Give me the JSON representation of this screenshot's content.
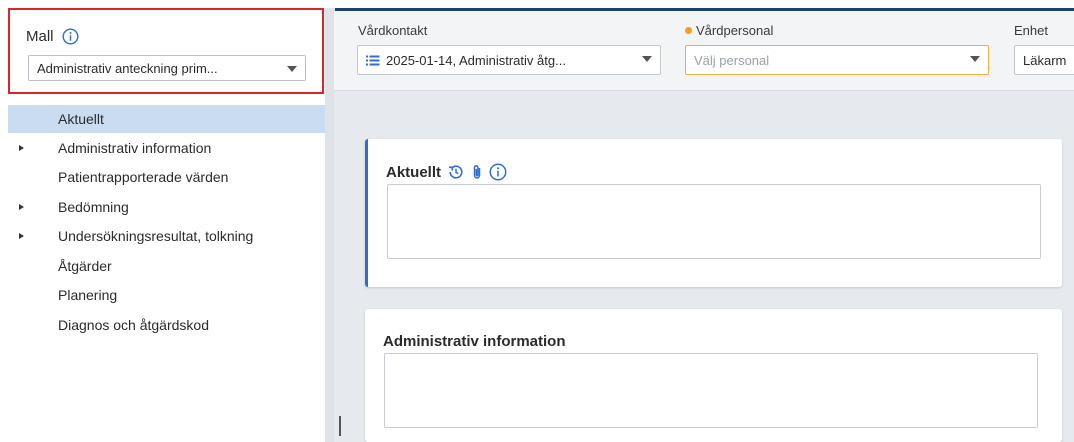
{
  "mall": {
    "label": "Mall",
    "selected": "Administrativ anteckning prim..."
  },
  "nav": {
    "items": [
      {
        "label": "Aktuellt",
        "expandable": false,
        "active": true
      },
      {
        "label": "Administrativ information",
        "expandable": true,
        "active": false
      },
      {
        "label": "Patientrapporterade värden",
        "expandable": false,
        "active": false
      },
      {
        "label": "Bedömning",
        "expandable": true,
        "active": false
      },
      {
        "label": "Undersökningsresultat, tolkning",
        "expandable": true,
        "active": false
      },
      {
        "label": "Åtgärder",
        "expandable": false,
        "active": false
      },
      {
        "label": "Planering",
        "expandable": false,
        "active": false
      },
      {
        "label": "Diagnos och åtgärdskod",
        "expandable": false,
        "active": false
      }
    ]
  },
  "header": {
    "vardkontakt": {
      "label": "Vårdkontakt",
      "value": "2025-01-14, Administrativ åtg..."
    },
    "vardpersonal": {
      "label": "Vårdpersonal",
      "placeholder": "Välj personal"
    },
    "enhet": {
      "label": "Enhet",
      "value": "Läkarm"
    }
  },
  "sections": {
    "aktuellt": {
      "title": "Aktuellt"
    },
    "administrativ": {
      "title": "Administrativ information"
    }
  },
  "colors": {
    "accent": "#2d6fd0",
    "highlight_border": "#d9262a",
    "required_dot": "#f0a020",
    "nav_active": "#c9dcf0",
    "top_bar": "#1f3f73"
  },
  "icons": {
    "info": "info-icon",
    "history": "history-icon",
    "attachment": "paperclip-icon",
    "list": "list-icon",
    "dropdown": "chevron-down-icon",
    "expand": "expand-arrow-icon"
  }
}
